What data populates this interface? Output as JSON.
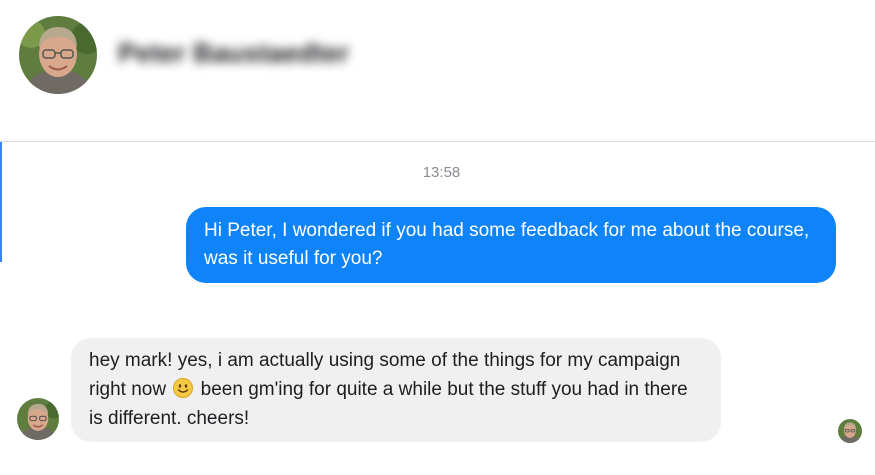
{
  "contact": {
    "name": "Peter Baustaedter",
    "avatar_icon": "user-photo-avatar"
  },
  "conversation": {
    "timestamp": "13:58",
    "messages": [
      {
        "direction": "outgoing",
        "text": "Hi Peter, I wondered if you had some feedback for me about the course, was it useful for you?"
      },
      {
        "direction": "incoming",
        "text_before_emoji": "hey mark! yes, i am actually using some of the things for my campaign right now",
        "emoji": "slightly-smiling-face-icon",
        "text_after_emoji": "been gm'ing for quite a while but the stuff you had in there is different. cheers!"
      }
    ]
  },
  "colors": {
    "outgoing_bubble": "#0f84f8",
    "incoming_bubble": "#f0f0f0",
    "timestamp": "#8a8d91"
  }
}
